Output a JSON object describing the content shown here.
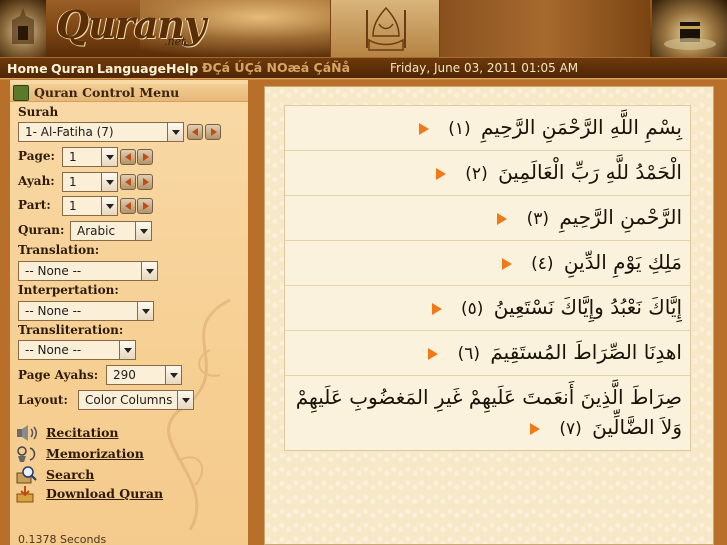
{
  "brand": {
    "name": "Qurany",
    "suffix": ".net"
  },
  "nav": {
    "links": [
      "Home",
      "Quran",
      "Language",
      "Help"
    ],
    "garbled_text": "ÐÇá ÚÇá NOæá ÇáÑå",
    "datetime": "Friday, June 03, 2011 01:05 AM"
  },
  "sidebar": {
    "title": "Quran Control Menu",
    "surah_label": "Surah",
    "surah_value": "1- Al-Fatiha (7)",
    "page_label": "Page:",
    "page_value": "1",
    "ayah_label": "Ayah:",
    "ayah_value": "1",
    "part_label": "Part:",
    "part_value": "1",
    "quran_label": "Quran:",
    "quran_value": "Arabic",
    "translation_label": "Translation:",
    "translation_value": "-- None --",
    "interpretation_label": "Interpertation:",
    "interpretation_value": "-- None --",
    "transliteration_label": "Transliteration:",
    "transliteration_value": "-- None --",
    "page_ayahs_label": "Page Ayahs:",
    "page_ayahs_value": "290",
    "layout_label": "Layout:",
    "layout_value": "Color Columns",
    "menu": [
      {
        "label": "Recitation",
        "icon": "speaker-icon"
      },
      {
        "label": "Memorization",
        "icon": "memorize-icon"
      },
      {
        "label": "Search",
        "icon": "search-icon"
      },
      {
        "label": "Download Quran",
        "icon": "download-icon"
      }
    ],
    "timing": "0.1378 Seconds"
  },
  "ayahs": [
    {
      "text": "بِسْمِ اللَّهِ الرَّحْمَنِ الرَّحِيمِ",
      "num": "١"
    },
    {
      "text": "الْحَمْدُ للَّهِ رَبِّ الْعَالَمِينَ",
      "num": "٢"
    },
    {
      "text": "الرَّحْمنِ الرَّحِيمِ",
      "num": "٣"
    },
    {
      "text": "مَلِكِ يَوْمِ الدِّينِ",
      "num": "٤"
    },
    {
      "text": "إِيَّاكَ نَعْبُدُ وإِيَّاكَ نَسْتَعِينُ",
      "num": "٥"
    },
    {
      "text": "اهدِنَا الصِّرَاطَ المُستَقِيمَ",
      "num": "٦"
    },
    {
      "text": "صِرَاطَ الَّذِينَ أَنعَمتَ عَلَيهِمْ غَيرِ المَغضُوبِ عَلَيهِمْ وَلاَ الضَّالِّينَ",
      "num": "٧"
    }
  ],
  "colors": {
    "accent_orange": "#f07a1a",
    "banner_brown": "#7a4412",
    "sidebar_bg": "#f9d9a6",
    "frame_brown": "#b86f2a"
  }
}
